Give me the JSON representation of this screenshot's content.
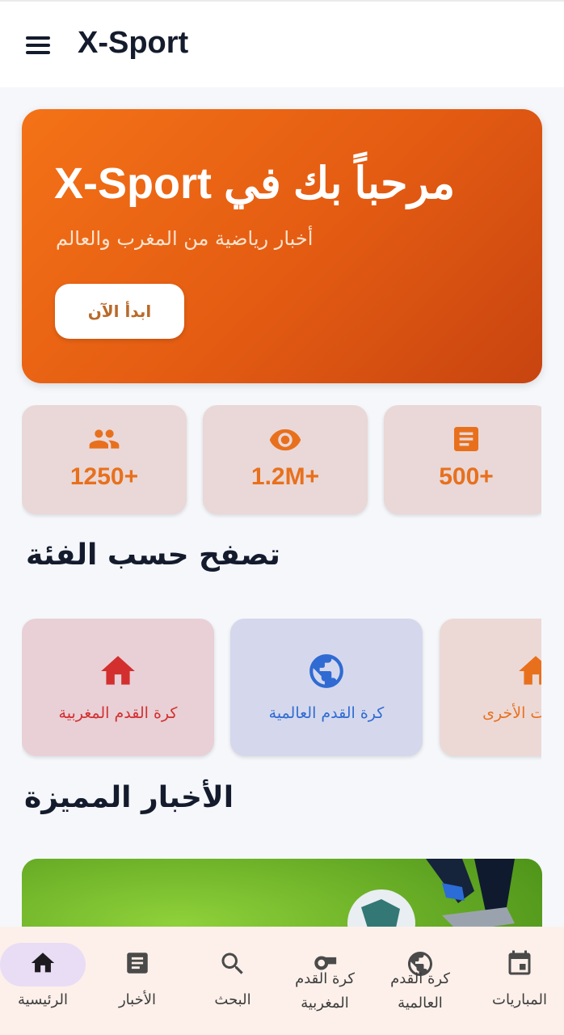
{
  "app": {
    "title": "X-Sport"
  },
  "hero": {
    "title": "مرحباً بك في X-Sport",
    "subtitle": "أخبار رياضية من المغرب والعالم",
    "button_label": "ابدأ الآن"
  },
  "stats": [
    {
      "icon": "people-icon",
      "value": "1250+"
    },
    {
      "icon": "eye-icon",
      "value": "1.2M+"
    },
    {
      "icon": "article-icon",
      "value": "500+"
    }
  ],
  "categories_section": {
    "title": "تصفح حسب الفئة",
    "items": [
      {
        "icon": "home-icon",
        "label": "كرة القدم المغربية",
        "color": "#d32f2f",
        "bg": "#e8d0d6"
      },
      {
        "icon": "globe-icon",
        "label": "كرة القدم العالمية",
        "color": "#2f6bd3",
        "bg": "#d5d8ec"
      },
      {
        "icon": "home-icon",
        "label": "الرياضات الأخرى",
        "color": "#e8701d",
        "bg": "#ecd9d6"
      }
    ]
  },
  "featured_section": {
    "title": "الأخبار المميزة"
  },
  "bottom_nav": {
    "items": [
      {
        "icon": "home-icon",
        "label": "الرئيسية",
        "active": true
      },
      {
        "icon": "article-icon",
        "label": "الأخبار"
      },
      {
        "icon": "search-icon",
        "label": "البحث"
      },
      {
        "icon": "whistle-icon",
        "label": "كرة القدم المغربية"
      },
      {
        "icon": "globe-icon",
        "label": "كرة القدم العالمية"
      },
      {
        "icon": "calendar-icon",
        "label": "المباريات"
      }
    ]
  },
  "colors": {
    "accent": "#e8701d",
    "hero_start": "#f47217",
    "hero_end": "#c84410",
    "text_dark": "#141b2d"
  }
}
